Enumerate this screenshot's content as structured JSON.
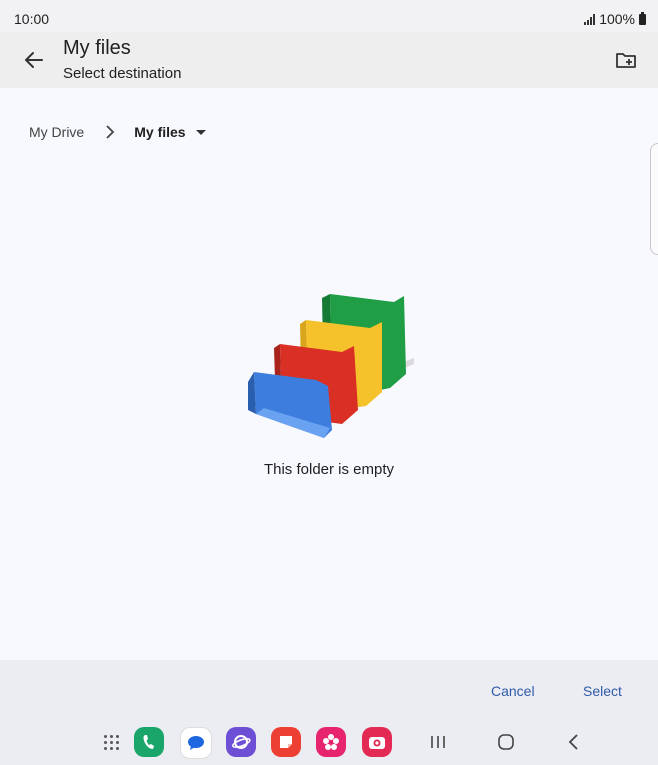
{
  "status_bar": {
    "time": "10:00",
    "battery_text": "100%"
  },
  "app_bar": {
    "title": "My files",
    "subtitle": "Select destination"
  },
  "breadcrumb": {
    "root": "My Drive",
    "current": "My files"
  },
  "empty_state": {
    "message": "This folder is empty"
  },
  "actions": {
    "cancel_label": "Cancel",
    "select_label": "Select"
  },
  "colors": {
    "accent": "#2f5aa8",
    "folder_blue": "#3c7ddd",
    "folder_red": "#d92f25",
    "folder_yellow": "#f6c22b",
    "folder_green": "#1f9e45"
  },
  "dock": {
    "apps": [
      "apps-grid-icon",
      "phone-icon",
      "messages-icon",
      "internet-icon",
      "notes-icon",
      "flower-icon",
      "camera-icon"
    ]
  }
}
